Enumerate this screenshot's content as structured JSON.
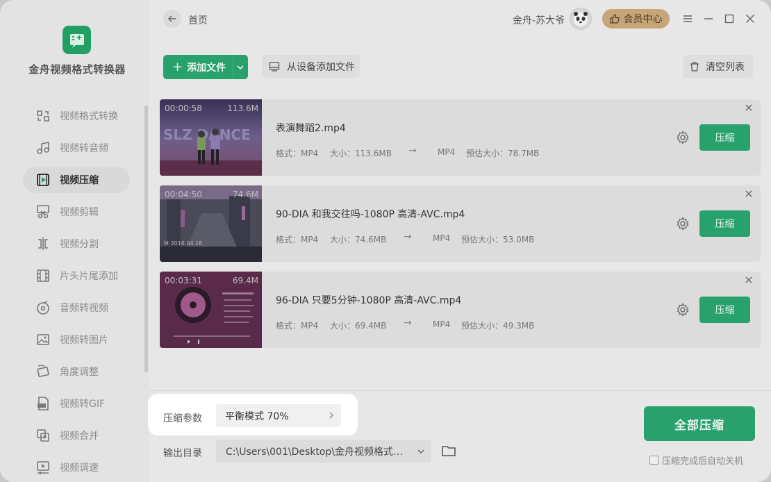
{
  "app": {
    "name": "金舟视频格式转换器"
  },
  "sidebar": {
    "items": [
      {
        "label": "视频格式转换",
        "icon": "format-convert-icon"
      },
      {
        "label": "视频转音频",
        "icon": "music-note-icon"
      },
      {
        "label": "视频压缩",
        "icon": "video-compress-icon",
        "active": true
      },
      {
        "label": "视频剪辑",
        "icon": "scissors-icon"
      },
      {
        "label": "视频分割",
        "icon": "split-icon"
      },
      {
        "label": "片头片尾添加",
        "icon": "film-icon"
      },
      {
        "label": "音频转视频",
        "icon": "disc-icon"
      },
      {
        "label": "视频转图片",
        "icon": "image-icon"
      },
      {
        "label": "角度调整",
        "icon": "rotate-icon"
      },
      {
        "label": "视频转GIF",
        "icon": "gif-icon"
      },
      {
        "label": "视频合并",
        "icon": "merge-icon"
      },
      {
        "label": "视频调速",
        "icon": "speed-icon"
      }
    ]
  },
  "header": {
    "home_label": "首页",
    "user_name": "金舟-苏大爷",
    "member_label": "会员中心"
  },
  "toolbar": {
    "add_file_label": "添加文件",
    "add_from_device_label": "从设备添加文件",
    "clear_list_label": "清空列表"
  },
  "files": [
    {
      "name": "表演舞蹈2.mp4",
      "duration": "00:00:58",
      "size_badge": "113.6M",
      "format_label": "格式：MP4",
      "size_label": "大小：113.6MB",
      "target_format": "MP4",
      "est_size_label": "预估大小：78.7MB",
      "compress_label": "压缩"
    },
    {
      "name": "90-DIA 和我交往吗-1080P 高清-AVC.mp4",
      "duration": "00:04:50",
      "size_badge": "74.6M",
      "format_label": "格式：MP4",
      "size_label": "大小：74.6MB",
      "target_format": "MP4",
      "est_size_label": "预估大小：53.0MB",
      "compress_label": "压缩"
    },
    {
      "name": "96-DIA 只要5分钟-1080P 高清-AVC.mp4",
      "duration": "00:03:31",
      "size_badge": "69.4M",
      "format_label": "格式：MP4",
      "size_label": "大小：69.4MB",
      "target_format": "MP4",
      "est_size_label": "预估大小：49.3MB",
      "compress_label": "压缩"
    }
  ],
  "bottom": {
    "param_label": "压缩参数",
    "param_value": "平衡模式 70%",
    "output_label": "输出目录",
    "output_path": "C:\\Users\\001\\Desktop\\金舟视频格式转...",
    "compress_all_label": "全部压缩",
    "auto_shutdown_label": "压缩完成后自动关机",
    "auto_shutdown_checked": false
  },
  "colors": {
    "accent": "#28a16c",
    "member": "#c6a578"
  }
}
